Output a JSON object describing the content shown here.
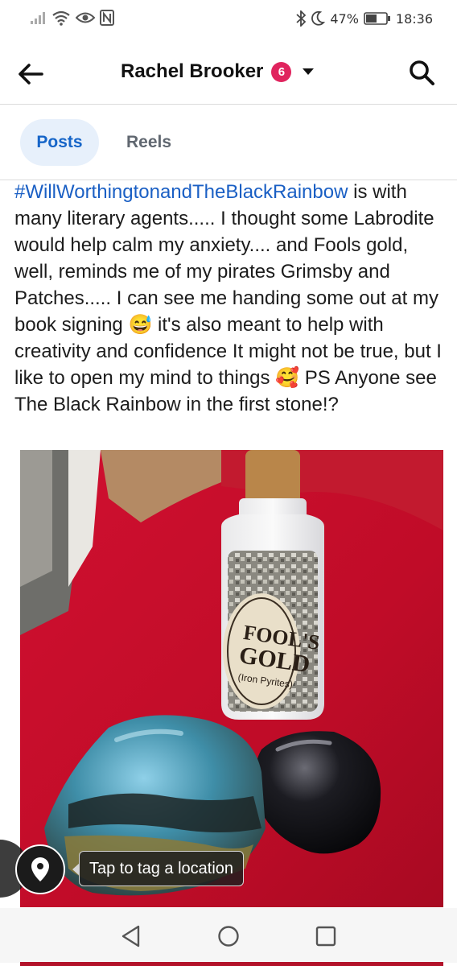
{
  "status_bar": {
    "battery_percent": "47%",
    "time": "18:36",
    "icons": [
      "signal-icon",
      "wifi-icon",
      "eye-icon",
      "nfc-icon",
      "bluetooth-icon",
      "moon-icon",
      "battery-icon"
    ]
  },
  "header": {
    "title": "Rachel Brooker",
    "badge_count": "6",
    "icons": [
      "back-arrow-icon",
      "dropdown-caret-icon",
      "search-icon"
    ]
  },
  "tabs": [
    {
      "label": "Posts",
      "active": true
    },
    {
      "label": "Reels",
      "active": false
    }
  ],
  "post": {
    "hashtag": "#WillWorthingtonandTheBlackRainbow",
    "text_part1": " is with many literary agents..... I thought some Labrodite would help calm my anxiety.... and Fools gold, well, reminds me of my pirates Grimsby and Patches..... I can see me handing some out at my book signing ",
    "emoji1": "😅",
    "text_part2": " it's also meant to help with creativity and confidence It might not be true, but I like to open my mind to things ",
    "emoji2": "🥰",
    "text_part3": " PS Anyone see The Black Rainbow in the first stone!?"
  },
  "photo": {
    "label_line1": "FOOL'S",
    "label_line2": "GOLD",
    "label_line3": "(Iron Pyrites)"
  },
  "location": {
    "tooltip": "Tap to tag a location",
    "icon": "location-pin-icon"
  },
  "colors": {
    "accent": "#1665c8",
    "badge": "#e0245e",
    "hashtag": "#1a5fc4"
  }
}
